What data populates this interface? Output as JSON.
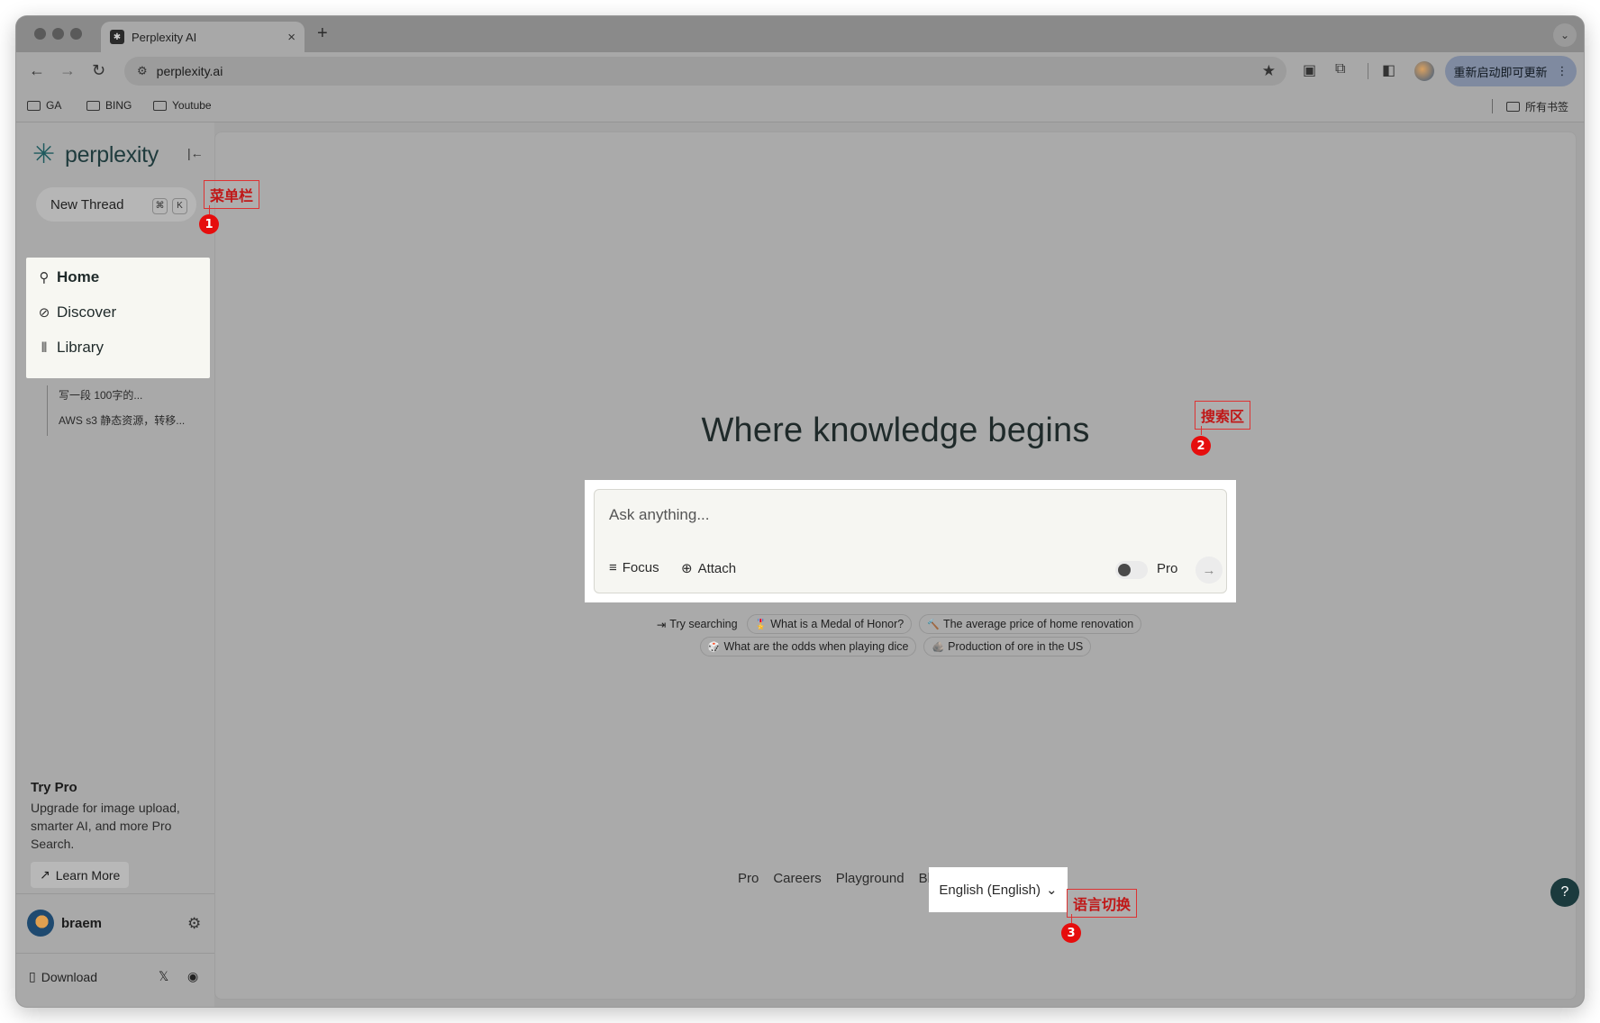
{
  "browser": {
    "tab_title": "Perplexity AI",
    "tab_close": "×",
    "new_tab": "+",
    "tab_menu": "⌄",
    "url": "perplexity.ai",
    "update_label": "重新启动即可更新",
    "bookmarks": [
      "GA",
      "BING",
      "Youtube"
    ],
    "all_bookmarks": "所有书签"
  },
  "sidebar": {
    "brand": "perplexity",
    "new_thread": "New Thread",
    "shortcut": [
      "⌘",
      "K"
    ],
    "nav": [
      {
        "label": "Home",
        "icon": "search-icon"
      },
      {
        "label": "Discover",
        "icon": "compass-icon"
      },
      {
        "label": "Library",
        "icon": "library-icon"
      }
    ],
    "threads": [
      "写一段 100字的...",
      "AWS s3 静态资源，转移..."
    ],
    "try_pro": {
      "title": "Try Pro",
      "desc": "Upgrade for image upload, smarter AI, and more Pro Search.",
      "button": "Learn More"
    },
    "user": "braem",
    "download": "Download"
  },
  "main": {
    "headline": "Where knowledge begins",
    "search_placeholder": "Ask anything...",
    "focus": "Focus",
    "attach": "Attach",
    "pro": "Pro",
    "try_searching": "Try searching",
    "suggestions_row1": [
      {
        "emoji": "🎖️",
        "text": "What is a Medal of Honor?"
      },
      {
        "emoji": "🔨",
        "text": "The average price of home renovation"
      }
    ],
    "suggestions_row2": [
      {
        "emoji": "🎲",
        "text": "What are the odds when playing dice"
      },
      {
        "emoji": "🪨",
        "text": "Production of ore in the US"
      }
    ],
    "footer": [
      "Pro",
      "Careers",
      "Playground",
      "Blog"
    ],
    "language": "English (English)",
    "help": "?"
  },
  "annotations": [
    {
      "num": "1",
      "label": "菜单栏"
    },
    {
      "num": "2",
      "label": "搜索区"
    },
    {
      "num": "3",
      "label": "语言切换"
    }
  ],
  "colors": {
    "brand": "#1f3b3d",
    "annotation": "#e60d0d",
    "help_button": "#1b3a3d"
  }
}
